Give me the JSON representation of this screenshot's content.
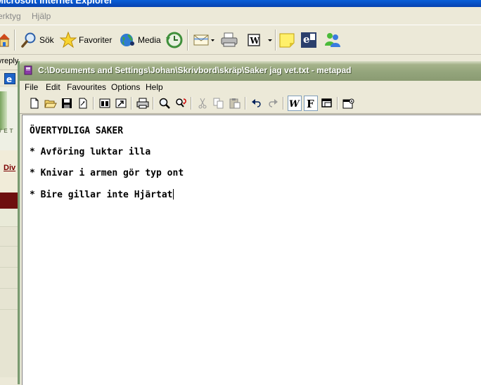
{
  "ie": {
    "title": "Microsoft Internet Explorer",
    "menu": [
      "erktyg",
      "Hjälp"
    ],
    "toolbar": {
      "search_label": "Sök",
      "favorites_label": "Favoriter",
      "media_label": "Media"
    },
    "address_fragment": "vreply",
    "page_fragments": {
      "logo_text": "VET",
      "link_text": "Div"
    }
  },
  "metapad": {
    "title": "C:\\Documents and Settings\\Johan\\Skrivbord\\skräp\\Saker jag vet.txt - metapad",
    "menu": [
      "File",
      "Edit",
      "Favourites",
      "Options",
      "Help"
    ],
    "content": {
      "heading": "ÖVERTYDLIGA SAKER",
      "lines": [
        "* Avföring luktar illa",
        "* Knivar i armen gör typ ont",
        "* Bire gillar inte Hjärtat"
      ]
    }
  }
}
